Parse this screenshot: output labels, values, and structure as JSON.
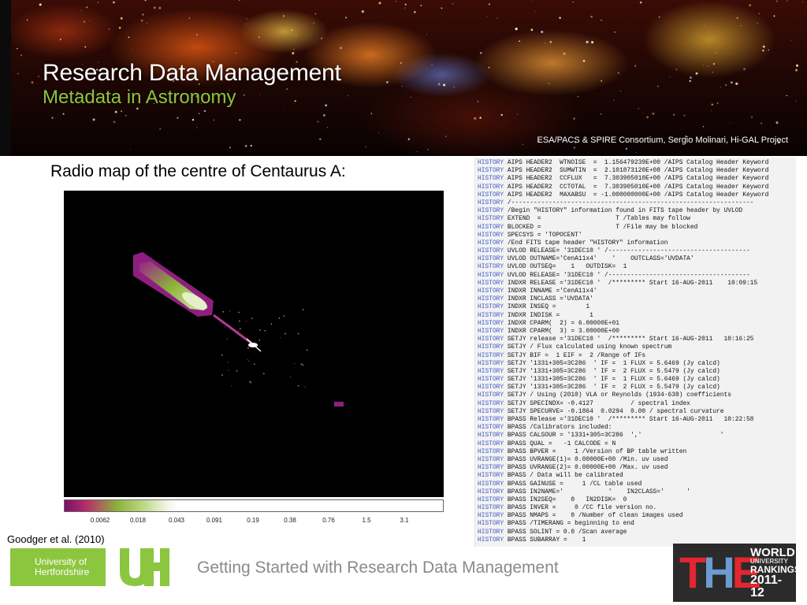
{
  "header": {
    "title": "Research Data Management",
    "subtitle": "Metadata in Astronomy",
    "image_credit": "ESA/PACS & SPIRE Consortium, Sergio Molinari, Hi-GAL Project"
  },
  "figure": {
    "caption": "Radio map of the centre of Centaurus A:",
    "colorbar_ticks": [
      "0.0062",
      "0.018",
      "0.043",
      "0.091",
      "0.19",
      "0.38",
      "0.76",
      "1.5",
      "3.1"
    ],
    "citation": "Goodger et al. (2010)"
  },
  "fits_header": {
    "keyword": "HISTORY",
    "lines": [
      "AIPS HEADER2  WTNOISE  =  1.156479239E+00 /AIPS Catalog Header Keyword",
      "AIPS HEADER2  SUMWTIN  =  2.101873120E+08 /AIPS Catalog Header Keyword",
      "AIPS HEADER2  CCFLUX   =  7.303905010E+00 /AIPS Catalog Header Keyword",
      "AIPS HEADER2  CCTOTAL  =  7.303905010E+00 /AIPS Catalog Header Keyword",
      "AIPS HEADER2  MAXABSU  = -1.000000000E+00 /AIPS Catalog Header Keyword",
      "/-----------------------------------------------------------------",
      "/Begin \"HISTORY\" information found in FITS tape header by UVLOD",
      "EXTEND  =                    T /Tables may follow",
      "BLOCKED =                    T /File may be blocked",
      "SPECSYS = 'TOPOCENT'",
      "/End FITS tape header \"HISTORY\" information",
      "UVLOD RELEASE= '31DEC10 ' /--------------------------------------",
      "UVLOD OUTNAME='CenA11x4'    '    OUTCLASS='UVDATA'",
      "UVLOD OUTSEQ=    1   OUTDISK=  1",
      "UVLOD RELEASE= '31DEC10 ' /--------------------------------------",
      "INDXR RELEASE ='31DEC10 '  /********* Start 16-AUG-2011    10:09:15",
      "INDXR INNAME ='CenA11x4'",
      "INDXR INCLASS ='UVDATA'",
      "INDXR INSEQ =        1",
      "INDXR INDISK =        1",
      "INDXR CPARM(  2) = 6.00000E+01",
      "INDXR CPARM(  3) = 3.00000E+00",
      "SETJY release ='31DEC10 '  /********* Start 16-AUG-2011   10:16:25",
      "SETJY / Flux calculated using known spectrum",
      "SETJY BIF =  1 EIF =  2 /Range of IFs",
      "SETJY '1331+305=3C286  ' IF =  1 FLUX = 5.6469 (Jy calcd)",
      "SETJY '1331+305=3C286  ' IF =  2 FLUX = 5.5479 (Jy calcd)",
      "SETJY '1331+305=3C286  ' IF =  1 FLUX = 5.6469 (Jy calcd)",
      "SETJY '1331+305=3C286  ' IF =  2 FLUX = 5.5479 (Jy calcd)",
      "SETJY / Using (2010) VLA or Reynolds (1934-638) coefficients",
      "SETJY SPECINDX= -0.4127          / spectral index",
      "SETJY SPECURVE= -0.1864  0.0294  0.00 / spectral curvature",
      "BPASS Release ='31DEC10 '  /********* Start 16-AUG-2011   10:22:58",
      "BPASS /Calibrators included:",
      "BPASS CALSOUR = '1331+305=3C286  ','                     '",
      "BPASS QUAL =   -1 CALCODE = N",
      "BPASS BPVER =     1 /Version of BP table written",
      "BPASS UVRANGE(1)= 0.00000E+00 /Min. uv used",
      "BPASS UVRANGE(2)= 0.00000E+00 /Max. uv used",
      "BPASS / Data will be calibrated",
      "BPASS GAINUSE =     1 /CL table used",
      "BPASS IN2NAME='            '    IN2CLASS='      '",
      "BPASS IN2SEQ=    0   IN2DISK=  0",
      "BPASS INVER =     0 /CC file version no.",
      "BPASS NMAPS =    0 /Number of clean images used",
      "BPASS /TIMERANG = beginning to end",
      "BPASS SOLINT = 0.0 /Scan average",
      "BPASS SUBARRAY =    1"
    ]
  },
  "footer": {
    "university_line1": "University of",
    "university_line2": "Hertfordshire",
    "university_mark": "UH",
    "title": "Getting Started with Research Data Management",
    "rankings_letters": "THE",
    "rankings_line1": "WORLD",
    "rankings_line2": "UNIVERSITY",
    "rankings_line3": "RANKINGS",
    "rankings_line4": "2011-12"
  },
  "colors": {
    "accent_green": "#8cc63f",
    "fits_keyword_blue": "#3b58c9",
    "footer_grey": "#8a8a8a"
  }
}
